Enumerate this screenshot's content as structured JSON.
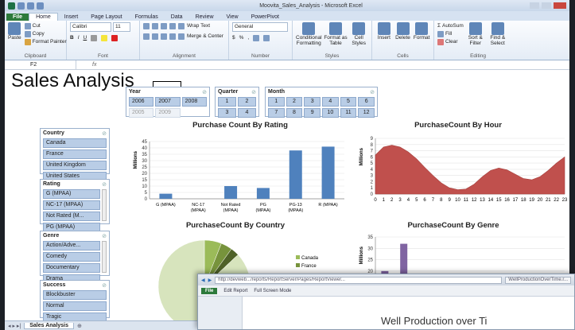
{
  "window": {
    "title": "Moovita_Sales_Analysis - Microsoft Excel"
  },
  "tabs": [
    "File",
    "Home",
    "Insert",
    "Page Layout",
    "Formulas",
    "Data",
    "Review",
    "View",
    "PowerPivot"
  ],
  "ribbon": {
    "clipboard": {
      "paste": "Paste",
      "cut": "Cut",
      "copy": "Copy",
      "format_painter": "Format Painter",
      "label": "Clipboard"
    },
    "font": {
      "name": "Calibri",
      "size": "11",
      "label": "Font"
    },
    "alignment": {
      "wrap": "Wrap Text",
      "merge": "Merge & Center",
      "label": "Alignment"
    },
    "number": {
      "format": "General",
      "label": "Number"
    },
    "styles": {
      "conditional": "Conditional Formatting",
      "format_table": "Format as Table",
      "cell_styles": "Cell Styles",
      "label": "Styles"
    },
    "cells": {
      "insert": "Insert",
      "delete": "Delete",
      "format": "Format",
      "label": "Cells"
    },
    "editing": {
      "autosum": "AutoSum",
      "fill": "Fill",
      "clear": "Clear",
      "sort": "Sort & Filter",
      "find": "Find & Select",
      "label": "Editing"
    }
  },
  "formula_bar": {
    "name_box": "F2",
    "fx": "fx"
  },
  "sheet_title": "Sales Analysis",
  "slicers": {
    "year": {
      "title": "Year",
      "items": [
        "2006",
        "2007",
        "2008",
        "2005",
        "2009"
      ]
    },
    "quarter": {
      "title": "Quarter",
      "items": [
        "1",
        "2",
        "3",
        "4"
      ]
    },
    "month": {
      "title": "Month",
      "items": [
        "1",
        "2",
        "3",
        "4",
        "5",
        "6",
        "7",
        "8",
        "9",
        "10",
        "11",
        "12"
      ]
    },
    "country": {
      "title": "Country",
      "items": [
        "Canada",
        "France",
        "United Kingdom",
        "United States"
      ]
    },
    "rating": {
      "title": "Rating",
      "items": [
        "G (MPAA)",
        "NC-17 (MPAA)",
        "Not Rated (M...",
        "PG (MPAA)"
      ]
    },
    "genre": {
      "title": "Genre",
      "items": [
        "Action/Adve...",
        "Comedy",
        "Documentary",
        "Drama"
      ]
    },
    "success": {
      "title": "Success",
      "items": [
        "Blockbuster",
        "Normal",
        "Tragic"
      ]
    }
  },
  "chart_data": [
    {
      "type": "bar",
      "title": "Purchase Count By Rating",
      "ylabel": "Millions",
      "categories": [
        "G (MPAA)",
        "NC-17 (MPAA)",
        "Not Rated (MPAA)",
        "PG (MPAA)",
        "PG-13 (MPAA)",
        "R (MPAA)"
      ],
      "values": [
        4,
        0,
        10,
        8.5,
        38,
        41
      ],
      "ylim": [
        0,
        45
      ],
      "yticks": [
        0,
        5,
        10,
        15,
        20,
        25,
        30,
        35,
        40,
        45
      ],
      "color": "#4f81bd"
    },
    {
      "type": "area",
      "title": "PurchaseCount By Hour",
      "ylabel": "Millions",
      "x": [
        0,
        1,
        2,
        3,
        4,
        5,
        6,
        7,
        8,
        9,
        10,
        11,
        12,
        13,
        14,
        15,
        16,
        17,
        18,
        19,
        20,
        21,
        22,
        23
      ],
      "values": [
        6.3,
        7.6,
        7.9,
        7.6,
        6.8,
        5.7,
        4.3,
        3.0,
        1.8,
        1.0,
        0.7,
        0.8,
        1.6,
        2.8,
        3.8,
        4.2,
        3.9,
        3.2,
        2.5,
        2.3,
        2.8,
        3.8,
        5.0,
        6.0
      ],
      "ylim": [
        0,
        9
      ],
      "yticks": [
        0,
        1,
        2,
        3,
        4,
        5,
        6,
        7,
        8,
        9
      ],
      "color": "#c0504d"
    },
    {
      "type": "pie",
      "title": "PurchaseCount By Country",
      "slices": [
        {
          "name": "Canada",
          "value": 6,
          "color": "#9bbb59"
        },
        {
          "name": "France",
          "value": 4,
          "color": "#77933c"
        },
        {
          "name": "United Kingdom",
          "value": 3,
          "color": "#4f6228"
        },
        {
          "name": "United States",
          "value": 87,
          "color": "#d7e4bd"
        }
      ],
      "legend_visible": [
        "Canada",
        "France"
      ]
    },
    {
      "type": "bar",
      "title": "PurchaseCount By Genre",
      "ylabel": "Millions",
      "values": [
        20,
        32,
        3,
        11,
        9,
        3,
        5,
        7,
        4,
        12
      ],
      "ylim": [
        0,
        35
      ],
      "yticks": [
        0,
        5,
        10,
        15,
        20,
        25,
        30,
        35
      ],
      "color": "#8064a2"
    }
  ],
  "sheet_tabs": {
    "active": "Sales Analysis"
  },
  "overlay": {
    "url": "http://devweb.../reports/ReportServer/Pages/ReportViewer...",
    "tab": "WellProductionOverTime.r...",
    "file": "File",
    "edit_report": "Edit Report",
    "full_screen": "Full Screen Mode",
    "title": "Well Production over Ti"
  }
}
